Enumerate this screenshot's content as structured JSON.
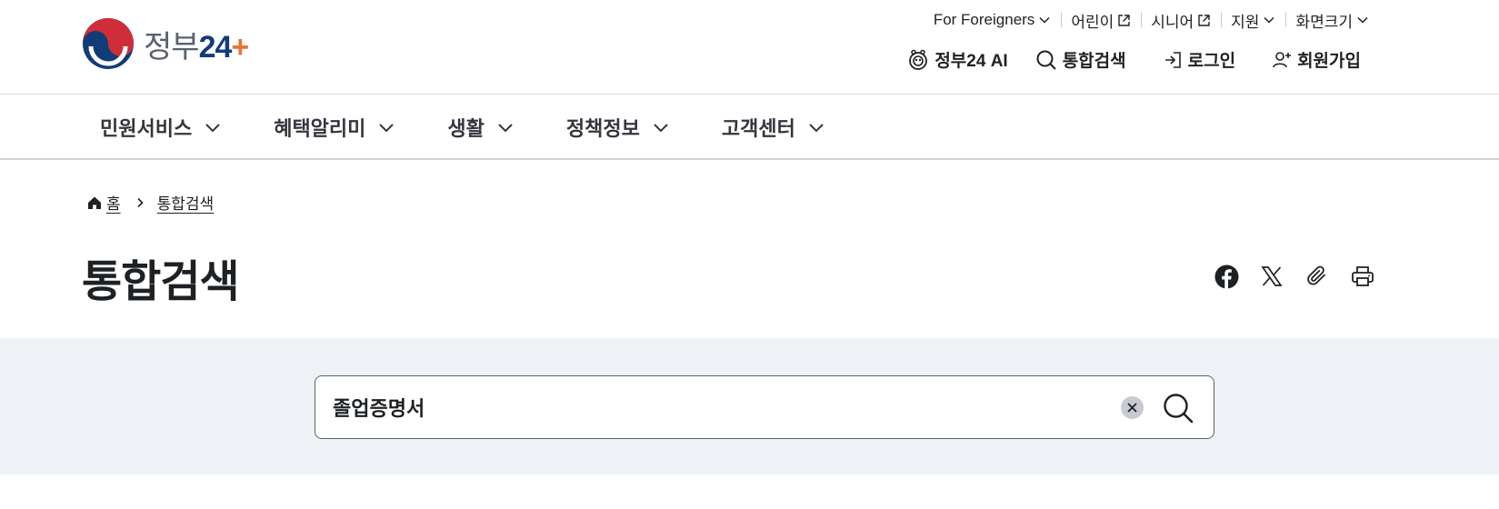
{
  "header": {
    "logo": {
      "text": "정부",
      "num": "24",
      "plus": "+"
    },
    "util_nav": [
      {
        "label": "For Foreigners",
        "icon": "chevron-down-icon"
      },
      {
        "label": "어린이",
        "icon": "external-link-icon"
      },
      {
        "label": "시니어",
        "icon": "external-link-icon"
      },
      {
        "label": "지원",
        "icon": "chevron-down-icon"
      },
      {
        "label": "화면크기",
        "icon": "chevron-down-icon"
      }
    ],
    "main_util": {
      "ai_label": "정부24 AI",
      "search_label": "통합검색",
      "login_label": "로그인",
      "signup_label": "회원가입"
    }
  },
  "gnb": {
    "items": [
      {
        "label": "민원서비스"
      },
      {
        "label": "혜택알리미"
      },
      {
        "label": "생활"
      },
      {
        "label": "정책정보"
      },
      {
        "label": "고객센터"
      }
    ]
  },
  "breadcrumb": {
    "home": "홈",
    "current": "통합검색"
  },
  "page": {
    "title": "통합검색"
  },
  "share": {
    "icons": [
      "facebook-icon",
      "x-icon",
      "paperclip-icon",
      "print-icon"
    ]
  },
  "search": {
    "value": "졸업증명서"
  },
  "colors": {
    "brand_navy": "#123c78",
    "brand_red": "#cd2e3a",
    "search_band": "#eef1f5",
    "logo_orange": "#e8743b"
  }
}
